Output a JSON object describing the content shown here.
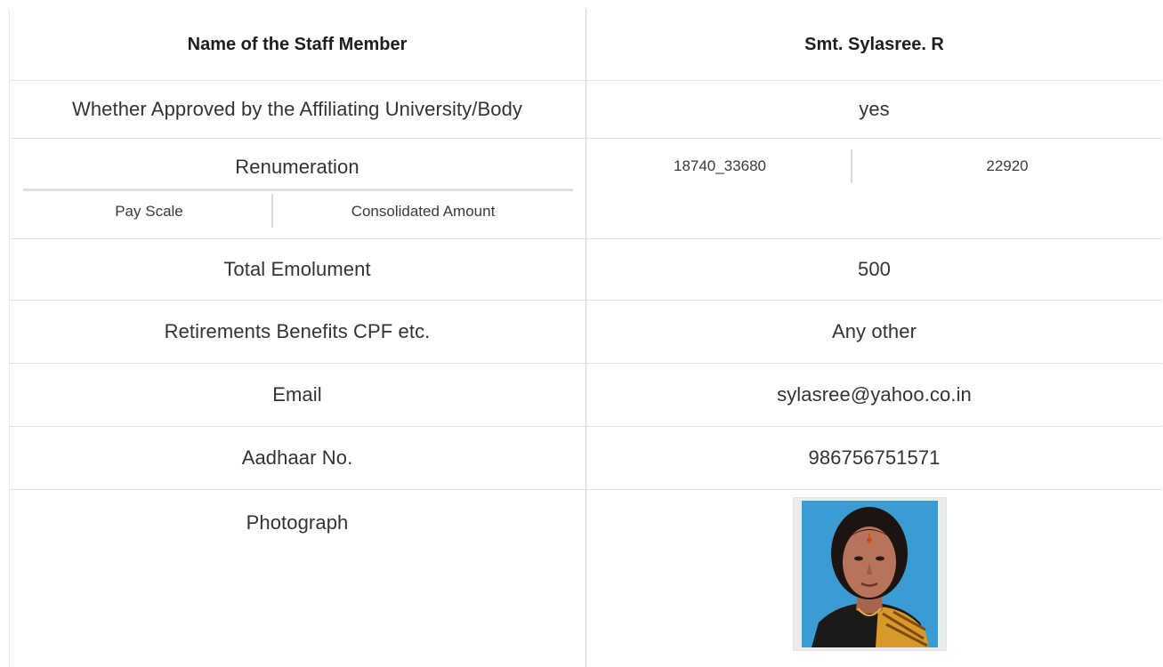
{
  "header": {
    "label": "Name of the Staff Member",
    "value": "Smt. Sylasree. R"
  },
  "rows": [
    {
      "label": "Whether Approved by the Affiliating University/Body",
      "value": "yes"
    },
    {
      "label": "Total Emolument",
      "value": "500"
    },
    {
      "label": "Retirements Benefits CPF etc.",
      "value": "Any other"
    },
    {
      "label": "Email",
      "value": "sylasree@yahoo.co.in"
    },
    {
      "label": "Aadhaar No.",
      "value": "986756751571"
    }
  ],
  "renumeration": {
    "label": "Renumeration",
    "pay_scale_label": "Pay Scale",
    "consolidated_label": "Consolidated Amount",
    "pay_scale_value": "18740_33680",
    "consolidated_value": "22920"
  },
  "photograph": {
    "label": "Photograph",
    "colors": {
      "background": "#3b9cd4",
      "hair": "#1c1410",
      "skin": "#b8745a",
      "saree": "#d9982a",
      "blouse": "#1a1a1a"
    }
  }
}
